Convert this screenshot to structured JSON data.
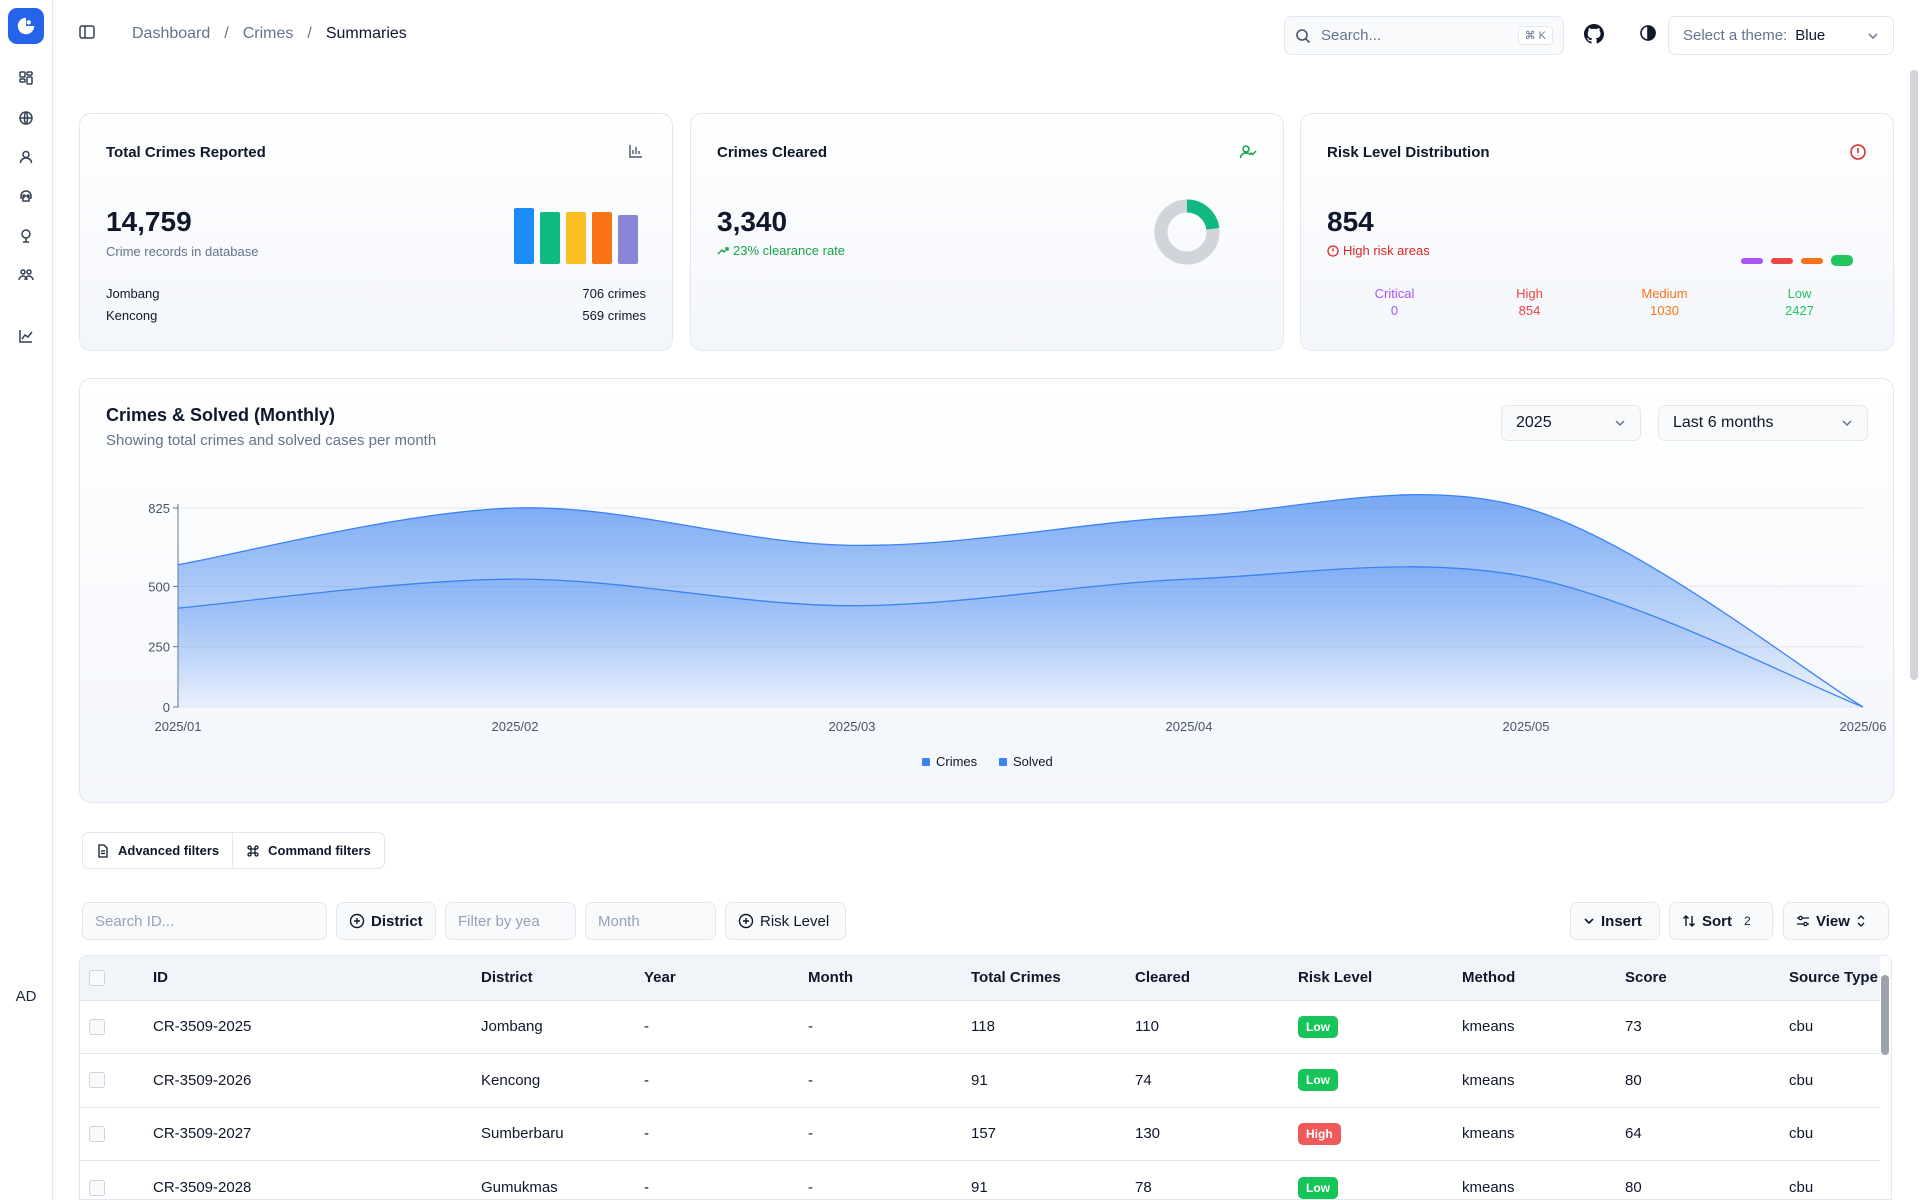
{
  "app": {
    "avatar_initials": "AD"
  },
  "breadcrumb": {
    "items": [
      "Dashboard",
      "Crimes"
    ],
    "current": "Summaries",
    "separator": "/"
  },
  "header": {
    "search_placeholder": "Search...",
    "search_shortcut": "⌘ K",
    "theme_label": "Select a theme:",
    "theme_value": "Blue"
  },
  "cards": {
    "total": {
      "title": "Total Crimes Reported",
      "value": "14,759",
      "subtitle": "Crime records in database",
      "rows": [
        {
          "name": "Jombang",
          "value": "706 crimes"
        },
        {
          "name": "Kencong",
          "value": "569 crimes"
        }
      ],
      "bar_colors": [
        "#1d8cf8",
        "#10b981",
        "#fbbf24",
        "#f97316",
        "#8b85d8"
      ],
      "bar_levels": [
        1.0,
        0.92,
        0.92,
        0.92,
        0.88
      ]
    },
    "cleared": {
      "title": "Crimes Cleared",
      "value": "3,340",
      "trend": "23% clearance rate",
      "ratio": 0.23
    },
    "risk": {
      "title": "Risk Level Distribution",
      "value": "854",
      "note": "High risk areas",
      "levels": [
        {
          "label": "Critical",
          "value": "0",
          "color": "#a855f7"
        },
        {
          "label": "High",
          "value": "854",
          "color": "#ef4444"
        },
        {
          "label": "Medium",
          "value": "1030",
          "color": "#f97316"
        },
        {
          "label": "Low",
          "value": "2427",
          "color": "#22c55e"
        }
      ]
    }
  },
  "chart": {
    "title": "Crimes & Solved (Monthly)",
    "subtitle": "Showing total crimes and solved cases per month",
    "year_select": "2025",
    "range_select": "Last 6 months"
  },
  "chart_data": {
    "type": "area",
    "x": [
      "2025/01",
      "2025/02",
      "2025/03",
      "2025/04",
      "2025/05",
      "2025/06"
    ],
    "series": [
      {
        "name": "Crimes",
        "values": [
          590,
          825,
          670,
          790,
          825,
          0
        ]
      },
      {
        "name": "Solved",
        "values": [
          410,
          530,
          420,
          530,
          540,
          0
        ]
      }
    ],
    "yticks": [
      0,
      250,
      500,
      825
    ],
    "ylim": [
      0,
      825
    ],
    "legend": "bottom",
    "colors": {
      "fill": "#4b8cf0",
      "stroke": "#3b82f6"
    }
  },
  "filters": {
    "tabs": [
      "Advanced filters",
      "Command filters"
    ],
    "search_id_placeholder": "Search ID...",
    "district": "District",
    "year_placeholder": "Filter by yea",
    "month_placeholder": "Month",
    "risk": "Risk Level",
    "insert": "Insert",
    "sort": "Sort",
    "sort_count": "2",
    "view": "View"
  },
  "table": {
    "columns": [
      "ID",
      "District",
      "Year",
      "Month",
      "Total Crimes",
      "Cleared",
      "Risk Level",
      "Method",
      "Score",
      "Source Type"
    ],
    "rows": [
      [
        "CR-3509-2025",
        "Jombang",
        "-",
        "-",
        "118",
        "110",
        "Low",
        "kmeans",
        "73",
        "cbu"
      ],
      [
        "CR-3509-2026",
        "Kencong",
        "-",
        "-",
        "91",
        "74",
        "Low",
        "kmeans",
        "80",
        "cbu"
      ],
      [
        "CR-3509-2027",
        "Sumberbaru",
        "-",
        "-",
        "157",
        "130",
        "High",
        "kmeans",
        "64",
        "cbu"
      ],
      [
        "CR-3509-2028",
        "Gumukmas",
        "-",
        "-",
        "91",
        "78",
        "Low",
        "kmeans",
        "80",
        "cbu"
      ]
    ],
    "badge_colors": {
      "Low": "#16c45a",
      "High": "#ee5a5a"
    }
  }
}
